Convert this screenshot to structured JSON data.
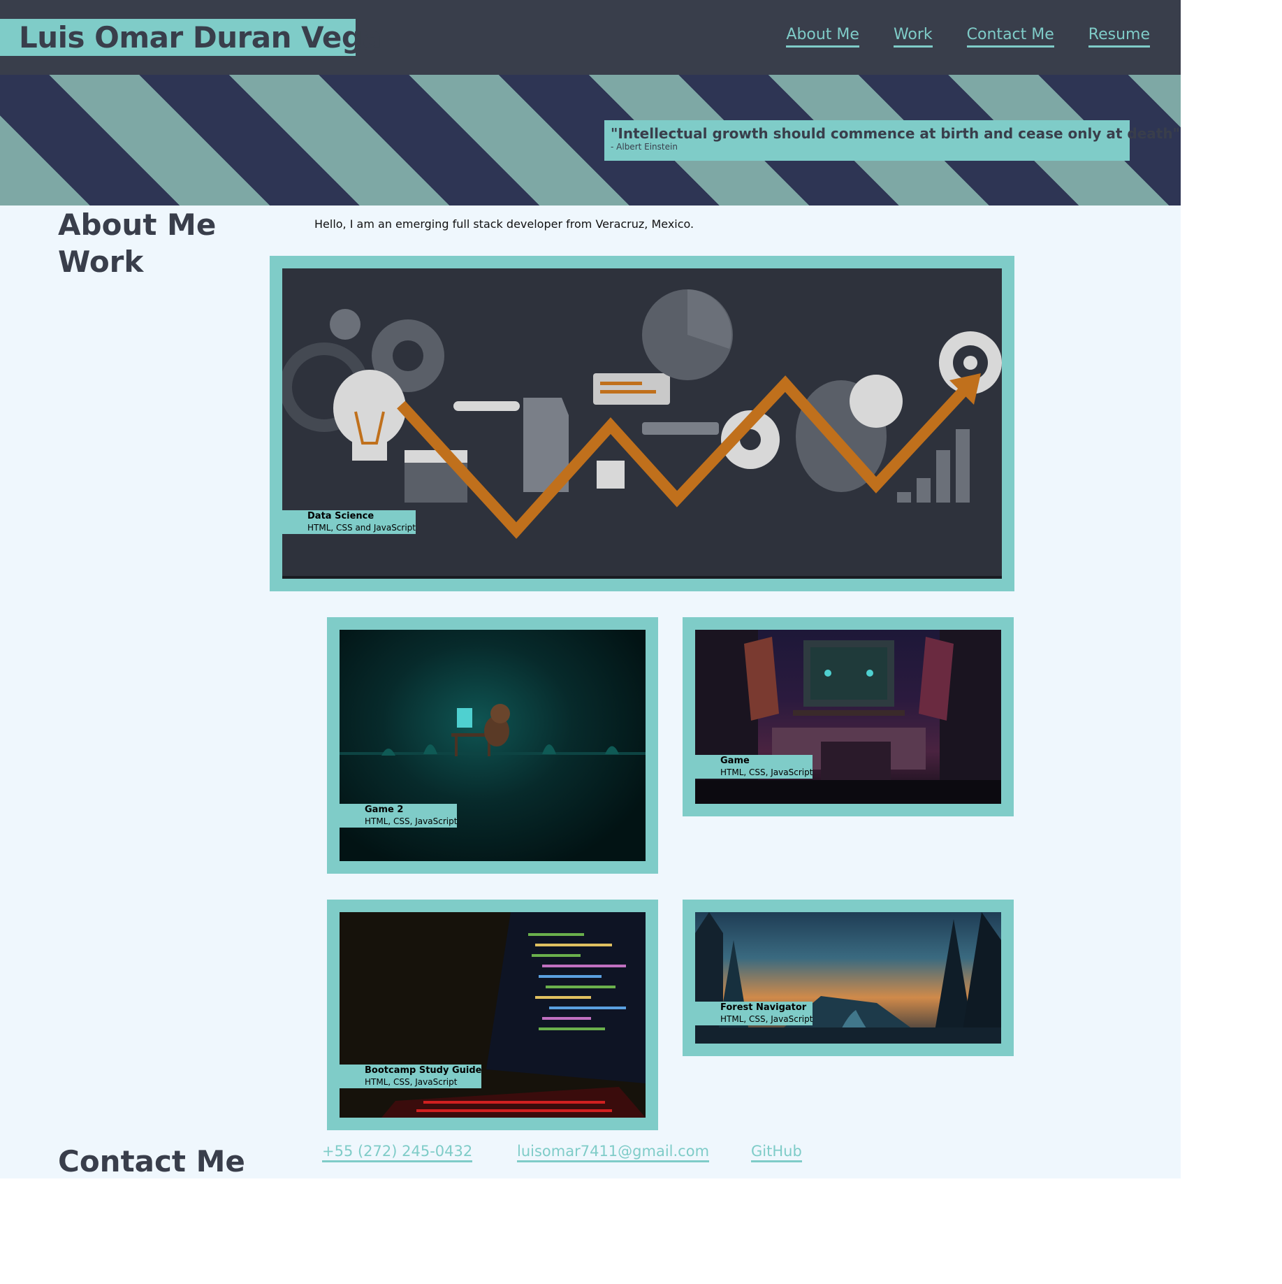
{
  "header": {
    "title": "Luis Omar Duran Vega",
    "nav": [
      "About Me",
      "Work",
      "Contact Me",
      "Resume"
    ]
  },
  "hero": {
    "quote": "\"Intellectual growth should commence at birth and cease only at death\"",
    "author": "- Albert Einstein"
  },
  "about": {
    "heading": "About Me",
    "text": "Hello, I am an emerging full stack developer from Veracruz, Mexico."
  },
  "work": {
    "heading": "Work",
    "projects": [
      {
        "name": "Data Science",
        "tech": "HTML, CSS and JavaScript"
      },
      {
        "name": "Game 2",
        "tech": "HTML, CSS, JavaScript"
      },
      {
        "name": "Game",
        "tech": "HTML, CSS, JavaScript"
      },
      {
        "name": "Bootcamp Study Guide",
        "tech": "HTML, CSS, JavaScript"
      },
      {
        "name": "Forest Navigator",
        "tech": "HTML, CSS, JavaScript"
      }
    ]
  },
  "contact": {
    "heading": "Contact Me",
    "phone": "+55 (272) 245-0432",
    "email": "luisomar7411@gmail.com",
    "github": "GitHub"
  },
  "colors": {
    "accent": "#7fccc8",
    "header_bg": "#393e4b",
    "page_bg": "#eff7fd",
    "stripe_dark": "#2e3554",
    "stripe_light": "#7ea8a5"
  }
}
